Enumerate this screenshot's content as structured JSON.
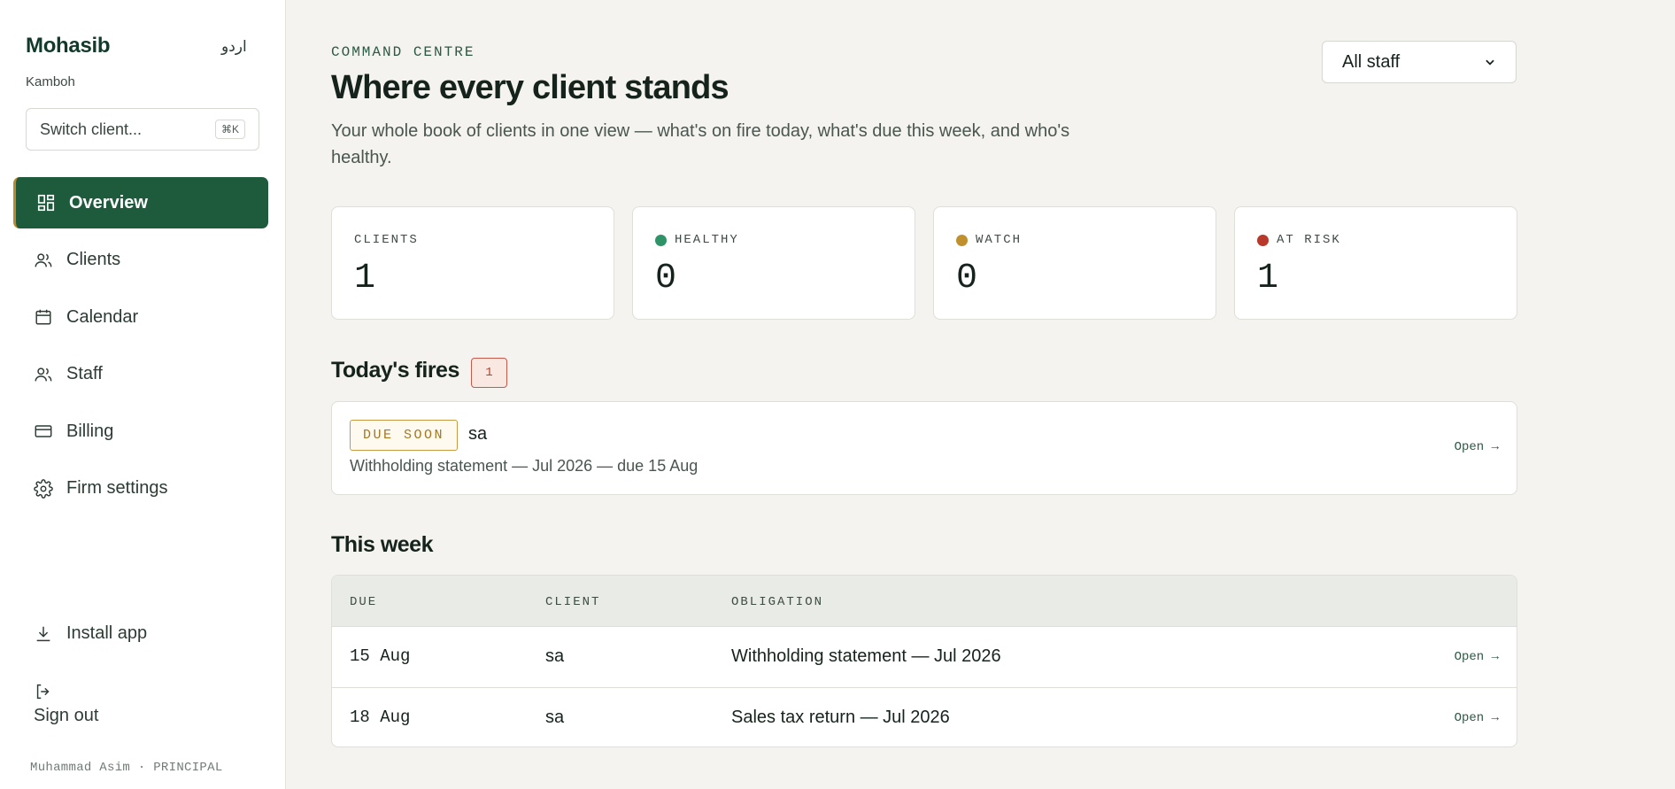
{
  "sidebar": {
    "brand": "Mohasib",
    "language_toggle": "اردو",
    "firm": "Kamboh",
    "switch_client": {
      "label": "Switch client...",
      "shortcut": "⌘K"
    },
    "nav": [
      {
        "label": "Overview",
        "icon": "grid-icon",
        "active": true
      },
      {
        "label": "Clients",
        "icon": "users-icon"
      },
      {
        "label": "Calendar",
        "icon": "calendar-icon"
      },
      {
        "label": "Staff",
        "icon": "users-icon"
      },
      {
        "label": "Billing",
        "icon": "credit-card-icon"
      },
      {
        "label": "Firm settings",
        "icon": "gear-icon"
      }
    ],
    "install_app": "Install app",
    "sign_out": "Sign out",
    "user": "Muhammad Asim · PRINCIPAL"
  },
  "header": {
    "eyebrow": "COMMAND CENTRE",
    "title": "Where every client stands",
    "subtitle": "Your whole book of clients in one view — what's on fire today, what's due this week, and who's healthy.",
    "staff_filter": "All staff"
  },
  "stats": [
    {
      "label": "CLIENTS",
      "value": "1",
      "dot_color": ""
    },
    {
      "label": "HEALTHY",
      "value": "0",
      "dot_color": "#2e9468"
    },
    {
      "label": "WATCH",
      "value": "0",
      "dot_color": "#c0902f"
    },
    {
      "label": "AT RISK",
      "value": "1",
      "dot_color": "#b8392b"
    }
  ],
  "fires": {
    "heading": "Today's fires",
    "count": "1",
    "items": [
      {
        "tag": "DUE SOON",
        "client": "sa",
        "description": "Withholding statement — Jul 2026 — due 15 Aug",
        "action": "Open →"
      }
    ]
  },
  "this_week": {
    "heading": "This week",
    "columns": [
      "DUE",
      "CLIENT",
      "OBLIGATION"
    ],
    "rows": [
      {
        "due": "15 Aug",
        "client": "sa",
        "obligation": "Withholding statement — Jul 2026",
        "action": "Open →"
      },
      {
        "due": "18 Aug",
        "client": "sa",
        "obligation": "Sales tax return — Jul 2026",
        "action": "Open →"
      }
    ]
  },
  "colors": {
    "accent": "#1e5a3c",
    "highlight": "#b8892e",
    "risk": "#b8392b"
  }
}
